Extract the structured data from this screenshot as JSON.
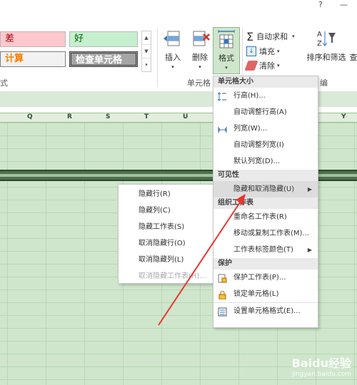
{
  "topbar": {
    "help": "?",
    "minimize": "—"
  },
  "styles": {
    "bad": "差",
    "good": "好",
    "calc": "计算",
    "check": "检查单元格",
    "group_label": "式"
  },
  "cells": {
    "insert_label": "插入",
    "delete_label": "删除",
    "format_label": "格式",
    "group_label": "单元格"
  },
  "editing": {
    "autosum_label": "自动求和",
    "fill_label": "填充",
    "clear_label": "清除",
    "sort_filter_label": "排序和筛选",
    "find_label": "查",
    "group_label": "编"
  },
  "columns": [
    "Q",
    "R",
    "S",
    "T",
    "U",
    "Y"
  ],
  "format_menu": {
    "cell_size_header": "单元格大小",
    "row_height": "行高(H)...",
    "autofit_row": "自动调整行高(A)",
    "col_width": "列宽(W)...",
    "autofit_col": "自动调整列宽(I)",
    "default_width": "默认列宽(D)...",
    "visibility_header": "可见性",
    "hide_unhide": "隐藏和取消隐藏(U)",
    "organize_header": "组织工作表",
    "rename_sheet": "重命名工作表(R)",
    "move_copy_sheet": "移动或复制工作表(M)...",
    "tab_color": "工作表标签颜色(T)",
    "protection_header": "保护",
    "protect_sheet": "保护工作表(P)...",
    "lock_cell": "锁定单元格(L)",
    "format_cells": "设置单元格格式(E)..."
  },
  "hide_submenu": {
    "hide_rows": "隐藏行(R)",
    "hide_cols": "隐藏列(C)",
    "hide_sheet": "隐藏工作表(S)",
    "unhide_rows": "取消隐藏行(O)",
    "unhide_cols": "取消隐藏列(L)",
    "unhide_sheet": "取消隐藏工作表(H)..."
  },
  "watermark": {
    "brand": "Baidu经验",
    "url": "jingyan.baidu.com"
  },
  "colors": {
    "accent": "#217346",
    "arrow": "#e8362f",
    "grid_bg": "#cfe6cc"
  }
}
